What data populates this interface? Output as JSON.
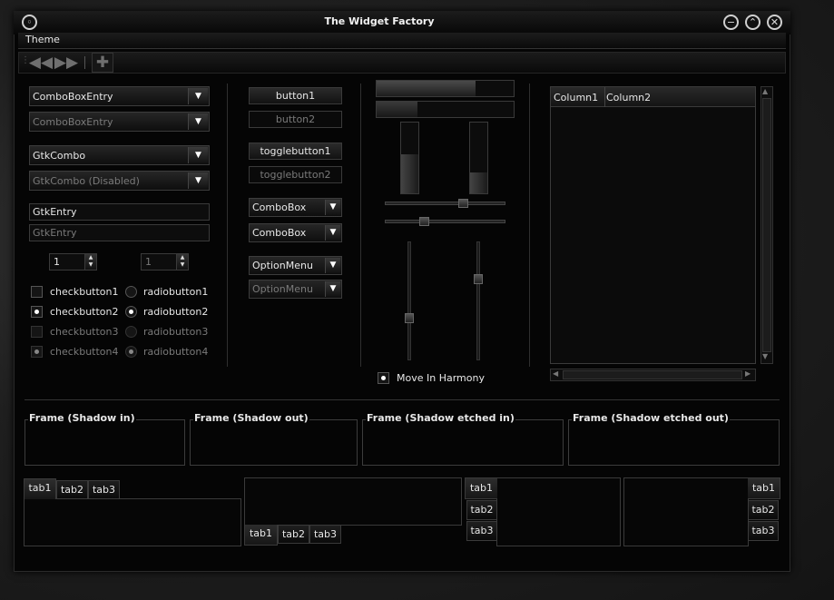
{
  "window": {
    "title": "The Widget Factory"
  },
  "menu": {
    "items": [
      "Theme"
    ]
  },
  "toolbar": {
    "icons": [
      "back-icon",
      "forward-icon",
      "add-icon"
    ]
  },
  "col1": {
    "comboboxentry": "ComboBoxEntry",
    "comboboxentry_disabled": "ComboBoxEntry",
    "gtkcombo": "GtkCombo",
    "gtkcombo_disabled": "GtkCombo (Disabled)",
    "gtkentry": "GtkEntry",
    "gtkentry_disabled": "GtkEntry",
    "spin1": "1",
    "spin2": "1",
    "checks": [
      "checkbutton1",
      "checkbutton2",
      "checkbutton3",
      "checkbutton4"
    ],
    "radios": [
      "radiobutton1",
      "radiobutton2",
      "radiobutton3",
      "radiobutton4"
    ]
  },
  "col2": {
    "button1": "button1",
    "button2": "button2",
    "toggle1": "togglebutton1",
    "toggle2": "togglebutton2",
    "combobox1": "ComboBox",
    "combobox2": "ComboBox",
    "option1": "OptionMenu",
    "option2": "OptionMenu"
  },
  "col3": {
    "harmony": "Move In Harmony",
    "progress_h1": 0.72,
    "progress_h2": 0.3,
    "progress_v1": 0.55,
    "progress_v2": 0.3
  },
  "tree": {
    "columns": [
      "Column1",
      "Column2"
    ]
  },
  "frames": [
    "Frame (Shadow in)",
    "Frame (Shadow out)",
    "Frame (Shadow etched in)",
    "Frame (Shadow etched out)"
  ],
  "tabs": {
    "top": [
      "tab1",
      "tab2",
      "tab3"
    ],
    "bottom": [
      "tab1",
      "tab2",
      "tab3"
    ],
    "left": [
      "tab1",
      "tab2",
      "tab3"
    ],
    "right": [
      "tab1",
      "tab2",
      "tab3"
    ]
  }
}
